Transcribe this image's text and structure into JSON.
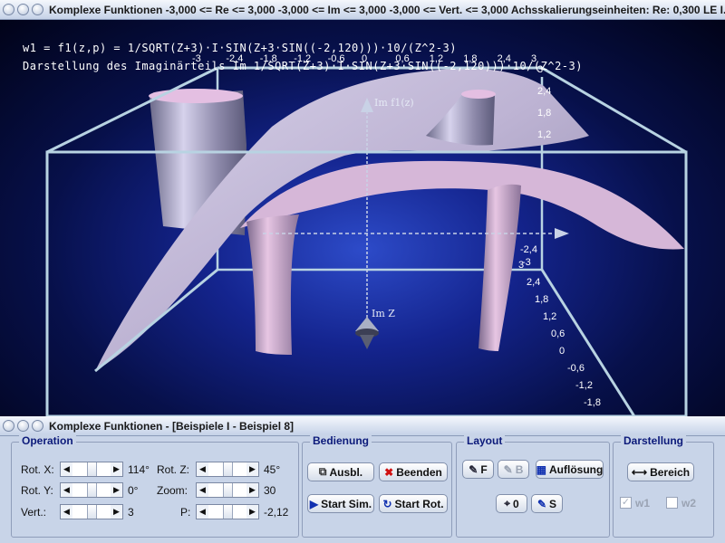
{
  "plot_window": {
    "title": "Komplexe Funktionen   -3,000 <= Re <= 3,000  -3,000 <= Im <= 3,000  -3,000 <= Vert. <= 3,000  Achsskalierungseinheiten:  Re: 0,300 LE    I...",
    "formula_line1": "w1 = f1(z,p) = 1/SQRT(Z+3)·I·SIN(Z+3·SIN((-2,120)))·10/(Z^2-3)",
    "formula_line2": "Darstellung des Imaginärteils Im 1/SQRT(Z+3)·I·SIN(Z+3·SIN((-2,120)))·10/(Z^2-3)",
    "axis_label_im_f": "Im f1(z)",
    "axis_label_im_z": "Im Z",
    "top_scale_ticks": [
      "-3",
      "-2,4",
      "-1,8",
      "-1,2",
      "-0,6",
      "0",
      "0,6",
      "1,2",
      "1,8",
      "2,4",
      "3"
    ],
    "right_scale_ticks_top": [
      "3",
      "2,4",
      "1,8",
      "1,2"
    ],
    "right_scale_ticks_mid": [
      "-2,4",
      "-3"
    ],
    "right_scale_ticks_lower": [
      "3",
      "2,4",
      "1,8",
      "1,2",
      "0,6",
      "0",
      "-0,6",
      "-1,2",
      "-1,8"
    ],
    "colors": {
      "surface": "#c9c4df",
      "box": "#b8d3e2",
      "bg_center": "#2d4bc9"
    }
  },
  "control_window": {
    "title": "Komplexe Funktionen - [Beispiele I - Beispiel 8]",
    "operation": {
      "label": "Operation",
      "rot_x_label": "Rot. X:",
      "rot_x_value": "114°",
      "rot_y_label": "Rot. Y:",
      "rot_y_value": "0°",
      "vert_label": "Vert.:",
      "vert_value": "3",
      "rot_z_label": "Rot. Z:",
      "rot_z_value": "45°",
      "zoom_label": "Zoom:",
      "zoom_value": "30",
      "p_label": "P:",
      "p_value": "-2,12"
    },
    "bedienung": {
      "label": "Bedienung",
      "ausbl": "Ausbl.",
      "beenden": "Beenden",
      "start_sim": "Start Sim.",
      "start_rot": "Start Rot."
    },
    "layout": {
      "label": "Layout",
      "f": "F",
      "b": "B",
      "aufloesung": "Auflösung",
      "o": "0",
      "s": "S"
    },
    "darstellung": {
      "label": "Darstellung",
      "bereich": "Bereich",
      "w1": "w1",
      "w2": "w2"
    }
  }
}
